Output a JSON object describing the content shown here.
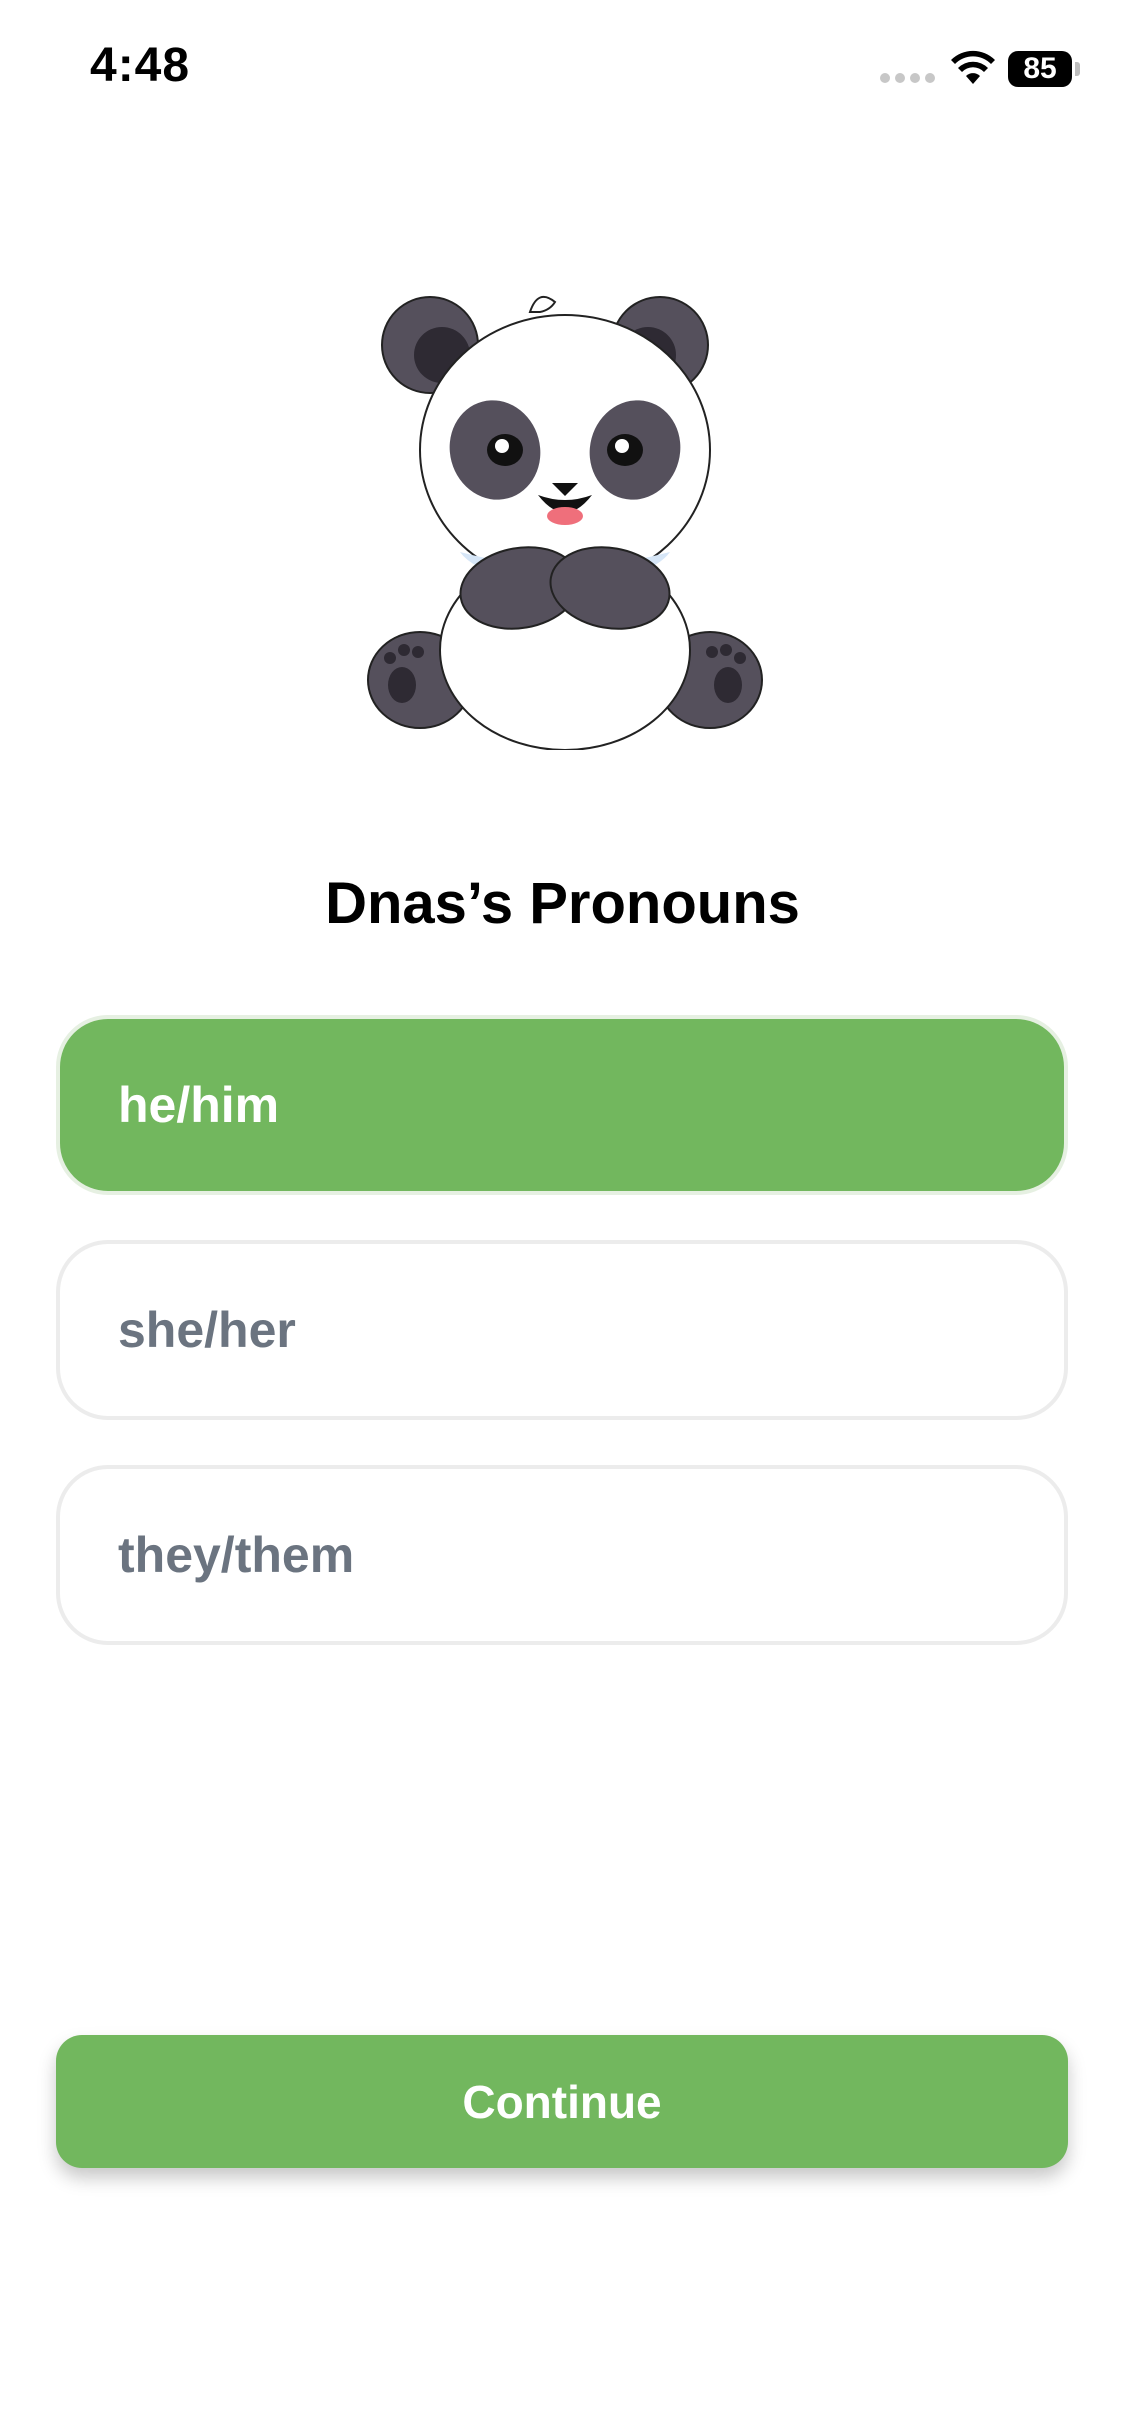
{
  "status_bar": {
    "time": "4:48",
    "battery_level": "85",
    "signal_icon": "cellular-signal-icon",
    "wifi_icon": "wifi-icon",
    "battery_icon": "battery-icon"
  },
  "mascot": {
    "icon": "panda-mascot-illustration"
  },
  "title": "Dnas’s Pronouns",
  "options": [
    {
      "label": "he/him",
      "selected": true
    },
    {
      "label": "she/her",
      "selected": false
    },
    {
      "label": "they/them",
      "selected": false
    }
  ],
  "continue_label": "Continue",
  "colors": {
    "accent_green": "#72b75e",
    "option_text_gray": "#6b7480",
    "option_border": "#ececec"
  }
}
